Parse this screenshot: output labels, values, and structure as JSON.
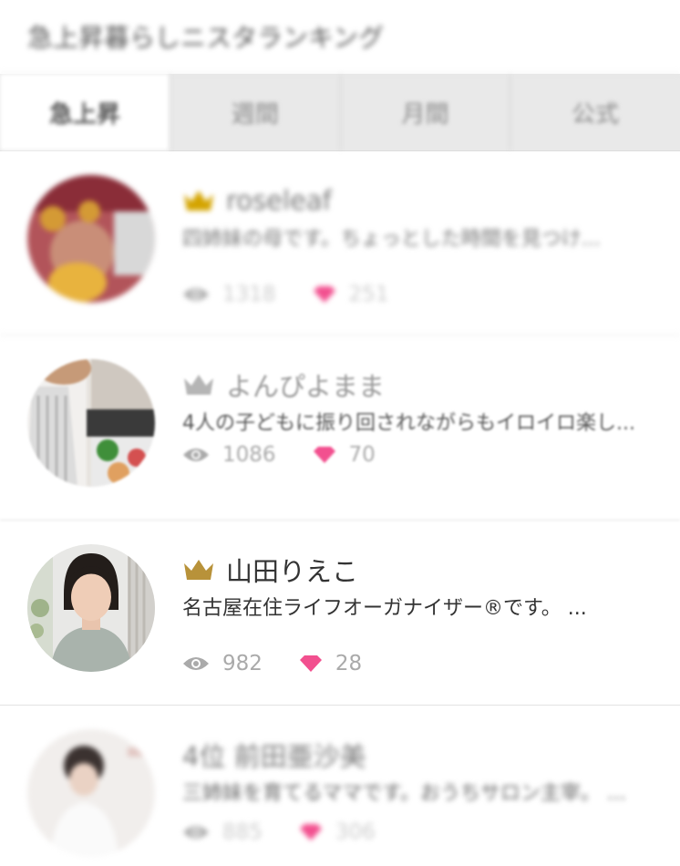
{
  "header": {
    "title": "急上昇暮らしニスタランキング"
  },
  "tabs": [
    {
      "label": "急上昇",
      "active": true
    },
    {
      "label": "週間",
      "active": false
    },
    {
      "label": "月間",
      "active": false
    },
    {
      "label": "公式",
      "active": false
    }
  ],
  "ranking": [
    {
      "name": "roseleaf",
      "crown": "gold",
      "description": "四姉妹の母です。ちょっとした時間を見つけ...",
      "views": "1318",
      "likes": "251"
    },
    {
      "name": "よんぴよまま",
      "crown": "silver",
      "description": "4人の子どもに振り回されながらもイロイロ楽し...",
      "views": "1086",
      "likes": "70"
    },
    {
      "name": "山田りえこ",
      "crown": "bronze",
      "description": "名古屋在住ライフオーガナイザー®です。 ...",
      "views": "982",
      "likes": "28"
    },
    {
      "name": "4位 前田亜沙美",
      "crown": "",
      "description": "三姉妹を育てるママです。おうちサロン主宰。 ...",
      "views": "885",
      "likes": "306"
    }
  ],
  "colors": {
    "gold": "#d4a400",
    "silver": "#b5b5b5",
    "bronze": "#b8923a",
    "heart": "#f2508f",
    "eye": "#aaaaaa"
  }
}
